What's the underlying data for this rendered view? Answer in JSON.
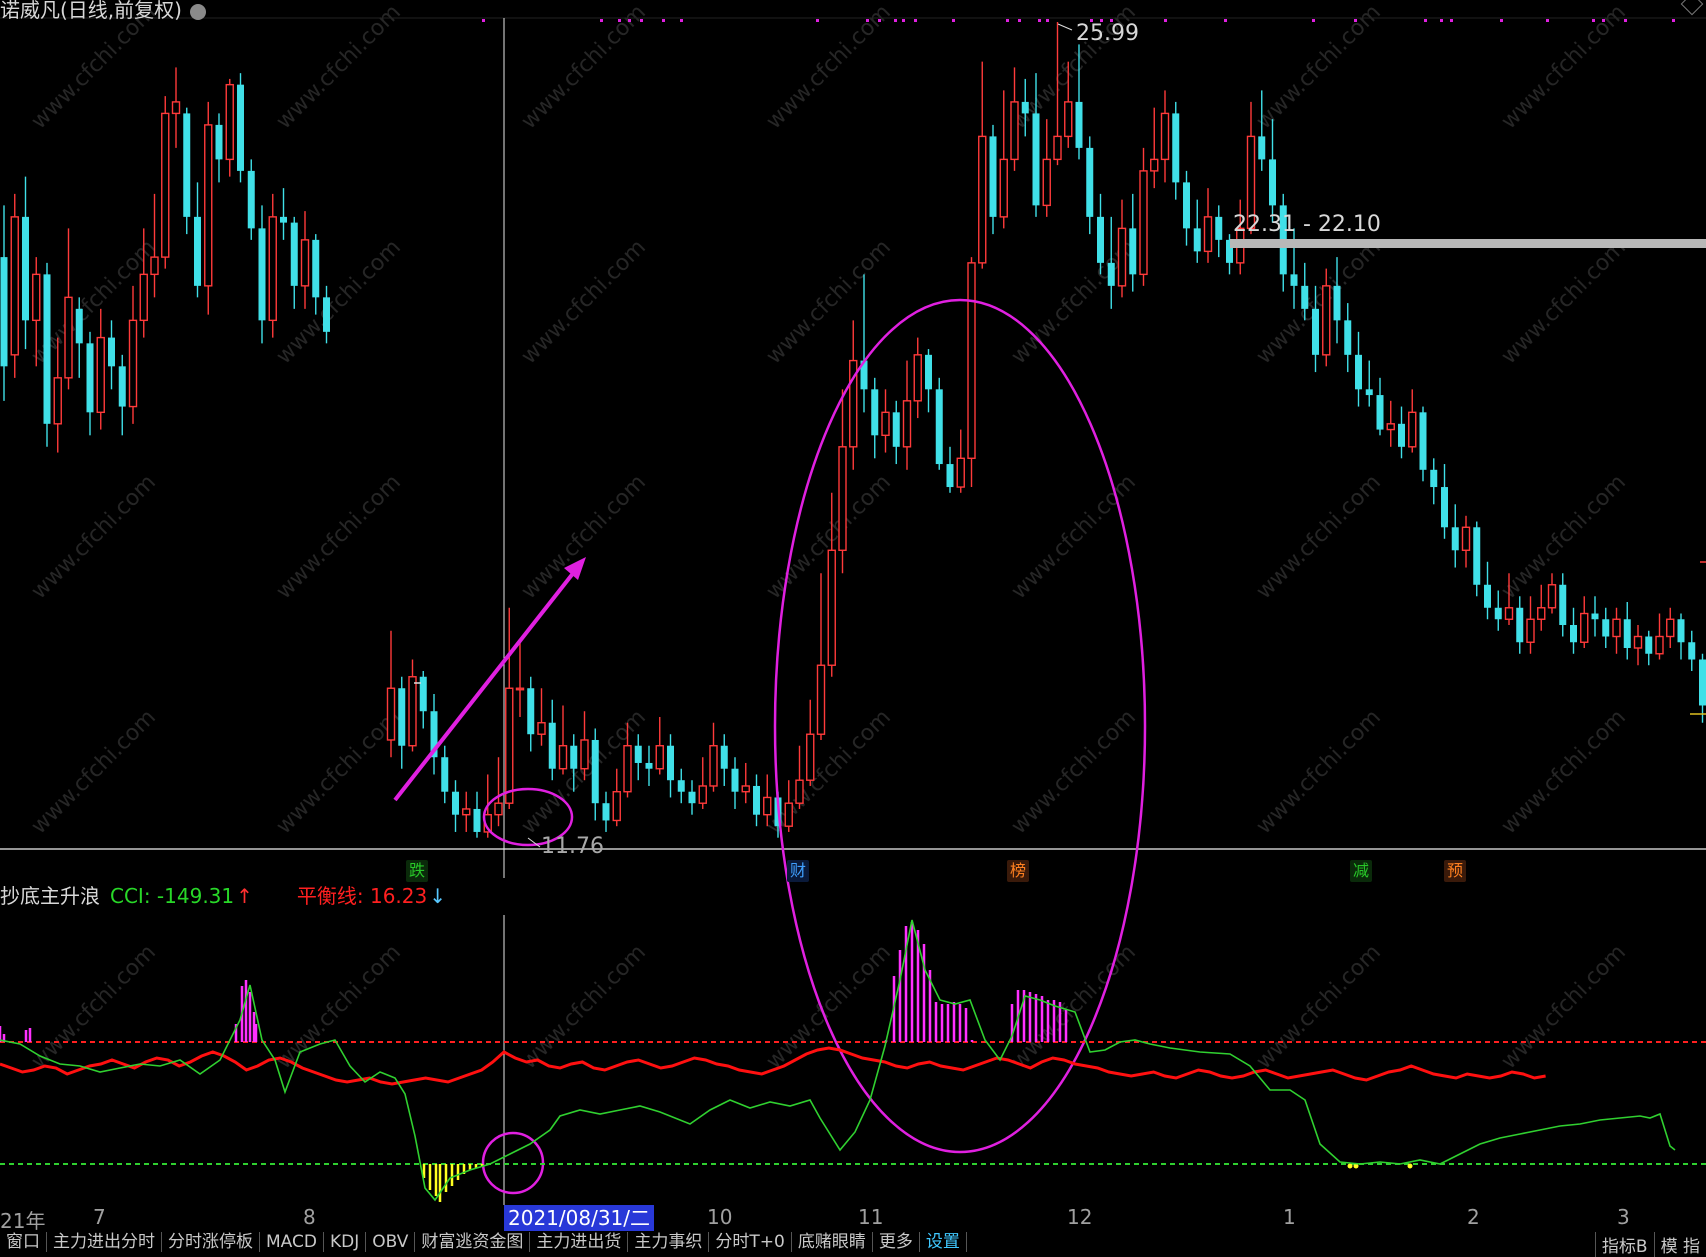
{
  "window": {
    "title": "诺威凡(日线,前复权)"
  },
  "price_panel": {
    "high_label": "25.99",
    "low_label": "11.76",
    "range_label": "22.31 - 22.10"
  },
  "markers": [
    {
      "text": "跌",
      "color": "#28c828",
      "bg": "#0a2a0a"
    },
    {
      "text": "财",
      "color": "#40a0ff",
      "bg": "#0a1a3a"
    },
    {
      "text": "榜",
      "color": "#ff8020",
      "bg": "#3a1a0a"
    },
    {
      "text": "减",
      "color": "#28c828",
      "bg": "#0a2a0a"
    },
    {
      "text": "预",
      "color": "#ff8020",
      "bg": "#3a1a0a"
    }
  ],
  "indicator": {
    "name": "抄底主升浪",
    "cci_text": "CCI: -149.31",
    "balance_text": "平衡线: 16.23",
    "up_arrow": "↑",
    "down_arrow": "↓"
  },
  "time_axis": {
    "labels": [
      "21年",
      "7",
      "8",
      "10",
      "11",
      "12",
      "1",
      "2",
      "3"
    ],
    "cursor_date": "2021/08/31/二"
  },
  "bottom_tabs": [
    "窗口",
    "主力进出分时",
    "分时涨停板",
    "MACD",
    "KDJ",
    "OBV",
    "财富逃资金图",
    "主力进出货",
    "主力事织",
    "分时T+0",
    "底赌眼睛",
    "更多",
    "设置"
  ],
  "bottom_right_tabs": [
    "指标B",
    "模 指"
  ],
  "watermark": "www.cfchi.com",
  "colors": {
    "up": "#ff3a3a",
    "down": "#40e0e8",
    "highlight": "#e020e0",
    "cci_line": "#30d030",
    "balance_line": "#ff1010",
    "bars_pos": "#ff30ff",
    "bars_neg": "#ffff20"
  },
  "candles": [
    [
      21.9,
      20.0,
      22.8,
      19.4
    ],
    [
      20.2,
      22.6,
      23.0,
      19.8
    ],
    [
      22.6,
      20.8,
      23.3,
      20.3
    ],
    [
      20.8,
      21.6,
      21.9,
      20.0
    ],
    [
      21.6,
      19.0,
      21.8,
      18.6
    ],
    [
      19.0,
      19.8,
      20.5,
      18.5
    ],
    [
      19.8,
      21.2,
      22.4,
      19.6
    ],
    [
      21.0,
      20.4,
      21.2,
      19.8
    ],
    [
      20.4,
      19.2,
      20.6,
      18.8
    ],
    [
      19.2,
      20.5,
      21.0,
      18.9
    ],
    [
      20.5,
      20.0,
      20.8,
      19.6
    ],
    [
      20.0,
      19.3,
      20.2,
      18.8
    ],
    [
      19.3,
      20.8,
      21.4,
      19.0
    ],
    [
      20.8,
      21.6,
      22.4,
      20.5
    ],
    [
      21.6,
      21.9,
      23.0,
      21.2
    ],
    [
      21.9,
      24.4,
      24.7,
      21.7
    ],
    [
      24.4,
      24.6,
      25.2,
      23.8
    ],
    [
      24.4,
      22.6,
      24.5,
      22.3
    ],
    [
      22.6,
      21.4,
      23.2,
      21.2
    ],
    [
      21.4,
      24.2,
      24.6,
      20.9
    ],
    [
      24.2,
      23.6,
      24.4,
      23.2
    ],
    [
      23.6,
      24.9,
      25.0,
      23.3
    ],
    [
      24.9,
      23.4,
      25.1,
      23.2
    ],
    [
      23.4,
      22.4,
      23.6,
      22.2
    ],
    [
      22.4,
      20.8,
      22.8,
      20.4
    ],
    [
      20.8,
      22.6,
      23.0,
      20.5
    ],
    [
      22.6,
      22.5,
      23.1,
      22.2
    ],
    [
      22.5,
      21.4,
      22.6,
      21.0
    ],
    [
      21.4,
      22.2,
      22.7,
      21.0
    ],
    [
      22.2,
      21.2,
      22.3,
      20.9
    ],
    [
      21.2,
      20.6,
      21.4,
      20.4
    ],
    [
      null,
      null,
      null,
      null
    ],
    [
      null,
      null,
      null,
      null
    ],
    [
      null,
      null,
      null,
      null
    ],
    [
      null,
      null,
      null,
      null
    ],
    [
      null,
      null,
      null,
      null
    ],
    [
      13.5,
      14.4,
      15.4,
      13.2
    ],
    [
      14.4,
      13.4,
      14.6,
      13.0
    ],
    [
      13.4,
      14.6,
      14.9,
      13.3
    ],
    [
      14.6,
      14.0,
      14.7,
      13.7
    ],
    [
      14.0,
      13.2,
      14.3,
      12.9
    ],
    [
      13.2,
      12.6,
      13.4,
      12.4
    ],
    [
      12.6,
      12.2,
      12.8,
      11.9
    ],
    [
      12.2,
      12.3,
      12.6,
      11.9
    ],
    [
      12.3,
      11.9,
      12.6,
      11.8
    ],
    [
      11.9,
      12.2,
      12.9,
      11.8
    ],
    [
      12.2,
      12.4,
      13.2,
      12.0
    ],
    [
      12.4,
      14.4,
      15.8,
      12.3
    ],
    [
      14.4,
      14.4,
      15.2,
      13.9
    ],
    [
      14.4,
      13.6,
      14.6,
      13.3
    ],
    [
      13.6,
      13.8,
      14.4,
      13.4
    ],
    [
      13.8,
      13.0,
      14.2,
      12.8
    ],
    [
      13.0,
      13.4,
      14.1,
      12.9
    ],
    [
      13.4,
      13.0,
      13.6,
      12.6
    ],
    [
      13.0,
      13.5,
      14.0,
      12.8
    ],
    [
      13.5,
      12.4,
      13.7,
      12.1
    ],
    [
      12.4,
      12.1,
      12.6,
      11.9
    ],
    [
      12.1,
      12.6,
      13.0,
      12.0
    ],
    [
      12.6,
      13.4,
      13.8,
      12.5
    ],
    [
      13.4,
      13.1,
      13.6,
      12.8
    ],
    [
      13.1,
      13.0,
      13.4,
      12.7
    ],
    [
      13.0,
      13.4,
      13.9,
      12.9
    ],
    [
      13.4,
      12.8,
      13.6,
      12.5
    ],
    [
      12.8,
      12.6,
      13.0,
      12.4
    ],
    [
      12.6,
      12.4,
      12.8,
      12.2
    ],
    [
      12.4,
      12.7,
      13.2,
      12.3
    ],
    [
      12.7,
      13.4,
      13.8,
      12.6
    ],
    [
      13.4,
      13.0,
      13.6,
      12.7
    ],
    [
      13.0,
      12.6,
      13.2,
      12.3
    ],
    [
      12.6,
      12.7,
      13.1,
      12.4
    ],
    [
      12.7,
      12.2,
      12.9,
      12.0
    ],
    [
      12.2,
      12.5,
      12.9,
      12.0
    ],
    [
      12.5,
      12.0,
      12.6,
      11.8
    ],
    [
      12.0,
      12.4,
      12.8,
      11.9
    ],
    [
      12.4,
      12.8,
      13.4,
      12.3
    ],
    [
      12.8,
      13.6,
      14.2,
      12.7
    ],
    [
      13.6,
      14.8,
      16.4,
      13.5
    ],
    [
      14.8,
      16.8,
      17.8,
      14.6
    ],
    [
      16.8,
      18.6,
      19.6,
      16.4
    ],
    [
      18.6,
      20.1,
      20.8,
      18.2
    ],
    [
      20.1,
      19.6,
      21.6,
      19.2
    ],
    [
      19.6,
      18.8,
      19.8,
      18.4
    ],
    [
      18.8,
      19.2,
      19.6,
      18.5
    ],
    [
      19.2,
      18.6,
      19.4,
      18.3
    ],
    [
      18.6,
      19.4,
      20.1,
      18.2
    ],
    [
      19.4,
      20.2,
      20.5,
      19.1
    ],
    [
      20.2,
      19.6,
      20.3,
      19.2
    ],
    [
      19.6,
      18.3,
      19.8,
      18.2
    ],
    [
      18.3,
      17.9,
      18.6,
      17.8
    ],
    [
      17.9,
      18.4,
      18.9,
      17.8
    ],
    [
      18.4,
      21.8,
      21.9,
      17.9
    ],
    [
      21.8,
      24.0,
      25.3,
      21.7
    ],
    [
      24.0,
      22.6,
      24.2,
      22.3
    ],
    [
      22.6,
      23.6,
      24.8,
      22.4
    ],
    [
      23.6,
      24.6,
      25.2,
      23.4
    ],
    [
      24.6,
      24.4,
      25.0,
      24.0
    ],
    [
      24.4,
      22.8,
      25.1,
      22.6
    ],
    [
      22.8,
      23.6,
      24.3,
      22.6
    ],
    [
      23.6,
      24.0,
      25.99,
      23.5
    ],
    [
      24.0,
      24.6,
      25.3,
      23.8
    ],
    [
      24.6,
      23.8,
      25.6,
      23.6
    ],
    [
      23.8,
      22.6,
      24.0,
      22.3
    ],
    [
      22.6,
      21.8,
      23.0,
      21.6
    ],
    [
      21.8,
      21.4,
      22.6,
      21.0
    ],
    [
      21.4,
      22.4,
      22.9,
      21.2
    ],
    [
      22.4,
      21.6,
      23.0,
      21.3
    ],
    [
      21.6,
      23.4,
      23.8,
      21.4
    ],
    [
      23.4,
      23.6,
      24.5,
      23.1
    ],
    [
      23.6,
      24.4,
      24.8,
      23.2
    ],
    [
      24.4,
      23.2,
      24.6,
      22.9
    ],
    [
      23.2,
      22.4,
      23.4,
      22.1
    ],
    [
      22.4,
      22.0,
      22.9,
      21.8
    ],
    [
      22.0,
      22.6,
      23.1,
      21.8
    ],
    [
      22.6,
      22.2,
      22.8,
      21.9
    ],
    [
      22.2,
      21.8,
      22.3,
      21.6
    ],
    [
      21.8,
      22.4,
      22.9,
      21.6
    ],
    [
      22.4,
      24.0,
      24.6,
      22.3
    ],
    [
      24.0,
      23.6,
      24.8,
      23.4
    ],
    [
      23.6,
      22.8,
      24.3,
      22.5
    ],
    [
      22.8,
      21.6,
      23.0,
      21.3
    ],
    [
      21.6,
      21.4,
      22.4,
      21.0
    ],
    [
      21.4,
      21.0,
      21.8,
      20.8
    ],
    [
      21.0,
      20.2,
      21.4,
      19.9
    ],
    [
      20.2,
      21.4,
      21.7,
      20.0
    ],
    [
      21.4,
      20.8,
      21.9,
      20.4
    ],
    [
      20.8,
      20.2,
      21.1,
      19.9
    ],
    [
      20.2,
      19.6,
      20.6,
      19.3
    ],
    [
      19.6,
      19.5,
      20.1,
      19.3
    ],
    [
      19.5,
      18.9,
      19.8,
      18.8
    ],
    [
      18.9,
      19.0,
      19.4,
      18.6
    ],
    [
      19.0,
      18.6,
      19.3,
      18.4
    ],
    [
      18.6,
      19.2,
      19.6,
      18.5
    ],
    [
      19.2,
      18.2,
      19.3,
      18.0
    ],
    [
      18.2,
      17.9,
      18.4,
      17.6
    ],
    [
      17.9,
      17.2,
      18.3,
      17.0
    ],
    [
      17.2,
      16.8,
      17.6,
      16.5
    ],
    [
      16.8,
      17.2,
      17.4,
      16.5
    ],
    [
      17.2,
      16.2,
      17.3,
      16.0
    ],
    [
      16.2,
      15.8,
      16.6,
      15.6
    ],
    [
      15.8,
      15.6,
      16.1,
      15.4
    ],
    [
      15.6,
      15.8,
      16.4,
      15.5
    ],
    [
      15.8,
      15.2,
      16.0,
      15.0
    ],
    [
      15.2,
      15.6,
      16.0,
      15.0
    ],
    [
      15.6,
      15.8,
      16.2,
      15.4
    ],
    [
      15.8,
      16.2,
      16.4,
      15.7
    ],
    [
      16.2,
      15.5,
      16.4,
      15.3
    ],
    [
      15.5,
      15.2,
      15.8,
      15.0
    ],
    [
      15.2,
      15.7,
      16.0,
      15.1
    ],
    [
      15.7,
      15.6,
      16.0,
      15.3
    ],
    [
      15.6,
      15.3,
      15.8,
      15.1
    ],
    [
      15.3,
      15.6,
      15.8,
      15.0
    ],
    [
      15.6,
      15.1,
      15.9,
      14.9
    ],
    [
      15.1,
      15.3,
      15.5,
      14.8
    ],
    [
      15.3,
      15.0,
      15.4,
      14.8
    ],
    [
      15.0,
      15.3,
      15.7,
      14.9
    ],
    [
      15.3,
      15.6,
      15.8,
      15.1
    ],
    [
      15.6,
      15.2,
      15.7,
      14.9
    ],
    [
      15.2,
      14.9,
      15.4,
      14.7
    ],
    [
      14.9,
      14.1,
      15.0,
      13.8
    ],
    [
      14.1,
      14.2,
      14.3,
      14.0
    ]
  ]
}
